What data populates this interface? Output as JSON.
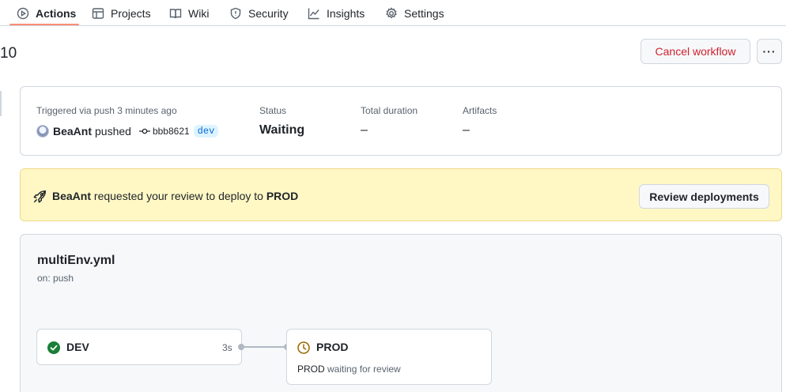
{
  "nav": {
    "tabs": [
      {
        "label": "Actions",
        "icon": "play-icon",
        "active": true
      },
      {
        "label": "Projects",
        "icon": "table-icon"
      },
      {
        "label": "Wiki",
        "icon": "book-icon"
      },
      {
        "label": "Security",
        "icon": "shield-icon"
      },
      {
        "label": "Insights",
        "icon": "graph-icon"
      },
      {
        "label": "Settings",
        "icon": "gear-icon"
      }
    ]
  },
  "header": {
    "run_number": "10",
    "cancel_label": "Cancel workflow",
    "more_label": "···"
  },
  "summary": {
    "triggered_label": "Triggered via push 3 minutes ago",
    "actor": "BeaAnt",
    "action": "pushed",
    "sha": "bbb8621",
    "branch": "dev",
    "status_label": "Status",
    "status_value": "Waiting",
    "duration_label": "Total duration",
    "duration_value": "–",
    "artifacts_label": "Artifacts",
    "artifacts_value": "–"
  },
  "review": {
    "actor": "BeaAnt",
    "middle_text": "requested your review to deploy to",
    "environment": "PROD",
    "button_label": "Review deployments"
  },
  "workflow": {
    "file": "multiEnv.yml",
    "trigger": "on: push",
    "jobs": [
      {
        "name": "DEV",
        "status": "success",
        "duration": "3s"
      },
      {
        "name": "PROD",
        "status": "waiting",
        "env": "PROD",
        "detail": "waiting for review"
      }
    ]
  },
  "colors": {
    "success": "#1a7f37",
    "waiting": "#9a6700",
    "danger": "#cf222e",
    "accent_underline": "#fd8c73",
    "banner_bg": "#fff8c5"
  }
}
